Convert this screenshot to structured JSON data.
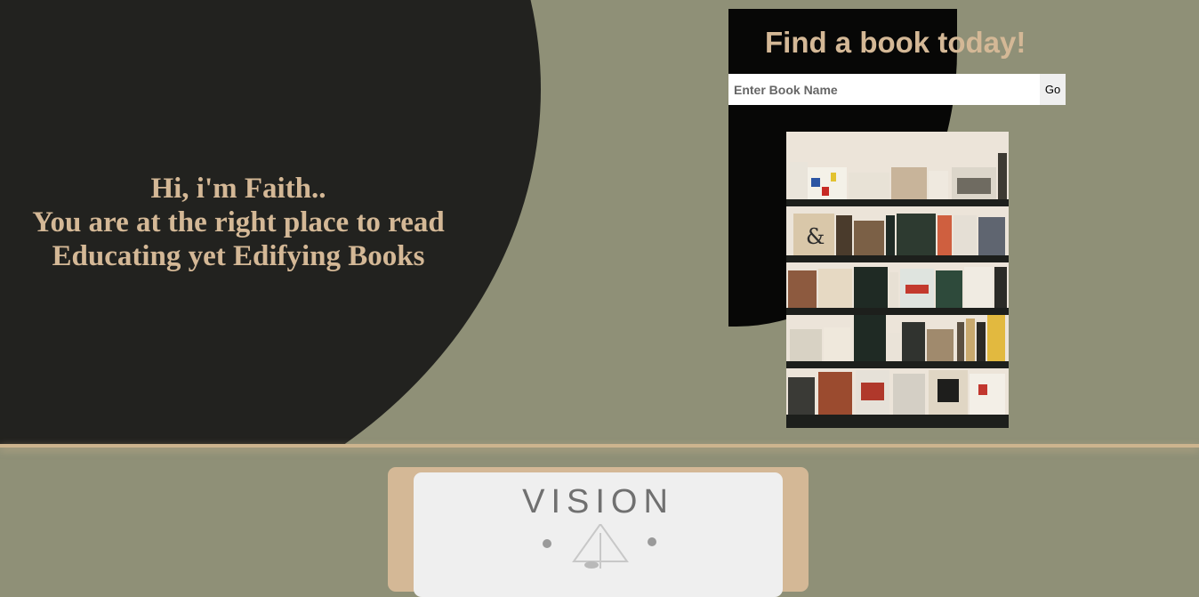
{
  "hero": {
    "line1": "Hi, i'm Faith..",
    "line2": "You are at the right place to read",
    "line3": "Educating yet Edifying Books"
  },
  "search": {
    "title": "Find a book today!",
    "placeholder": "Enter Book Name",
    "button_label": "Go"
  },
  "vision": {
    "heading": "VISION"
  },
  "colors": {
    "page_background": "#8f9077",
    "dark_panel": "#22221f",
    "accent_tan": "#d4b896"
  }
}
